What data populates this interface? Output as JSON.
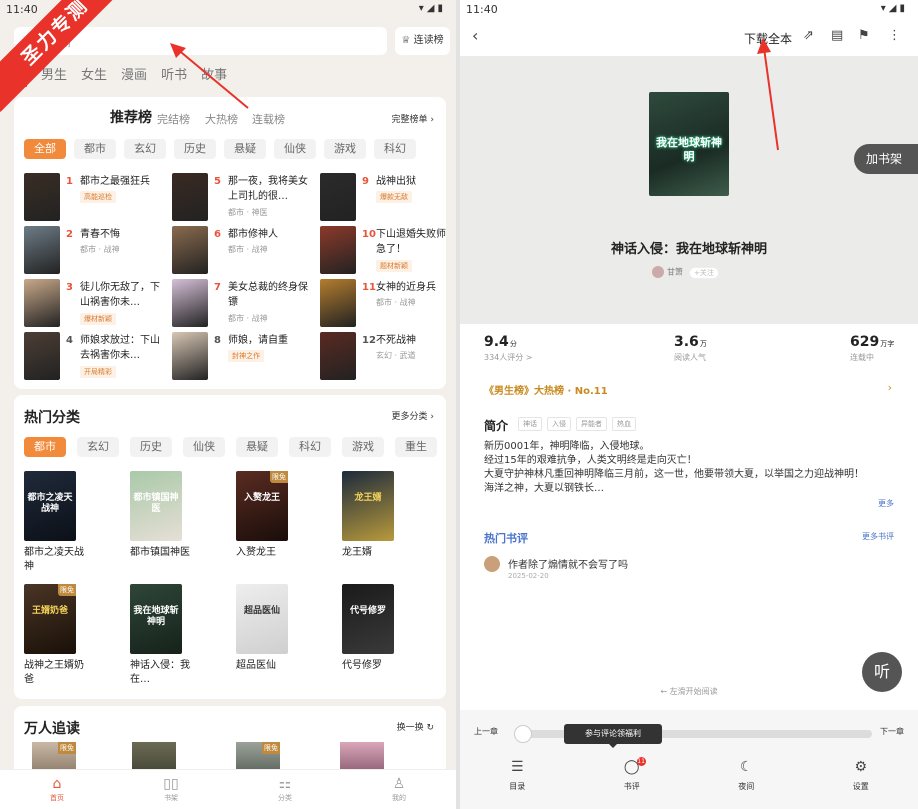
{
  "left": {
    "status": {
      "time": "11:40",
      "icons": "▾◢▮"
    },
    "ribbon": "圣力专测",
    "search": {
      "placeholder": "霸"
    },
    "rank_button": "连读榜",
    "tabs": [
      "说",
      "男生",
      "女生",
      "漫画",
      "听书",
      "故事"
    ],
    "recommend": {
      "title": "推荐榜",
      "subs": [
        "完结榜",
        "大热榜",
        "连载榜"
      ],
      "more": "完整榜单",
      "chips": [
        "全部",
        "都市",
        "玄幻",
        "历史",
        "悬疑",
        "仙侠",
        "游戏",
        "科幻"
      ],
      "items": [
        {
          "n": "1",
          "title": "都市之最强狂兵",
          "badge": "高能巡检"
        },
        {
          "n": "2",
          "title": "青春不悔",
          "tag": "都市 · 战神"
        },
        {
          "n": "3",
          "title": "徒儿你无敌了，下山祸害你未…",
          "badge": "爆材新颖"
        },
        {
          "n": "4",
          "title": "师娘求放过：下山去祸害你未…",
          "badge": "开局精彩"
        },
        {
          "n": "5",
          "title": "那一夜，我将美女上司扎的很…",
          "tag": "都市 · 神医"
        },
        {
          "n": "6",
          "title": "都市修神人",
          "tag": "都市 · 战神"
        },
        {
          "n": "7",
          "title": "美女总裁的终身保镖",
          "tag": "都市 · 战神"
        },
        {
          "n": "8",
          "title": "师娘，请自重",
          "badge": "封神之作"
        },
        {
          "n": "9",
          "title": "战神出狱",
          "badge": "爆款无敌"
        },
        {
          "n": "10",
          "title": "下山退婚失败师娘急了！",
          "badge": "题材新颖"
        },
        {
          "n": "11",
          "title": "女神的近身兵",
          "tag": "都市 · 战神"
        },
        {
          "n": "12",
          "title": "不死战神",
          "tag": "玄幻 · 武道"
        }
      ]
    },
    "hot": {
      "title": "热门分类",
      "more": "更多分类",
      "chips": [
        "都市",
        "玄幻",
        "历史",
        "仙侠",
        "悬疑",
        "科幻",
        "游戏",
        "重生"
      ],
      "books": [
        {
          "title": "都市之凌天战神"
        },
        {
          "title": "都市镇国神医"
        },
        {
          "title": "入赘龙王",
          "lim": "限免"
        },
        {
          "title": "龙王婿"
        },
        {
          "title": "战神之王婿奶爸",
          "lim": "限免"
        },
        {
          "title": "神话入侵：我在…"
        },
        {
          "title": "超品医仙"
        },
        {
          "title": "代号修罗"
        }
      ],
      "cover_texts": [
        "都市之凌天战神",
        "都市镇国神医",
        "入赘龙王",
        "龙王婿",
        "王婿奶爸",
        "我在地球斩神明",
        "超品医仙",
        "代号修罗"
      ]
    },
    "trending": {
      "title": "万人追读",
      "refresh": "换一换",
      "lim": "限免"
    },
    "nav": [
      "首页",
      "书架",
      "分类",
      "我的"
    ]
  },
  "right": {
    "status": {
      "time": "11:40",
      "icons": "▾◢▮"
    },
    "download": "下载全本",
    "add_shelf": "加书架",
    "cover_text": "我在地球斩神明",
    "book_title": "神话入侵：我在地球斩神明",
    "author": "甘箫",
    "follow": "+关注",
    "stats": [
      {
        "value": "9.4",
        "unit": "分",
        "label": "334人评分 >"
      },
      {
        "value": "3.6",
        "unit": "万",
        "label": "阅读人气"
      },
      {
        "value": "629",
        "unit": "万字",
        "label": "连载中"
      }
    ],
    "rank_line": "《男生榜》大热榜 · No.11",
    "intro_title": "简介",
    "intro_tags": [
      "神话",
      "入侵",
      "异能者",
      "热血"
    ],
    "intro": "新历0001年，神明降临，入侵地球。\n经过15年的艰难抗争，人类文明终是走向灭亡！\n大夏守护神林凡重回神明降临三月前，这一世，他要带领大夏，以举国之力迎战神明！\n海洋之神，大夏以钢铁长…",
    "intro_more": "更多",
    "review_title": "热门书评",
    "review_more": "更多书评",
    "review": {
      "text": "作者除了煽情就不会写了吗",
      "date": "2025-02-20"
    },
    "swipe": "← 左滑开始阅读",
    "listen": "听",
    "prev": "上一章",
    "next": "下一章",
    "tooltip": "参与评论领福利",
    "tools": [
      "目录",
      "书评",
      "夜间",
      "设置"
    ],
    "badge": "11"
  }
}
